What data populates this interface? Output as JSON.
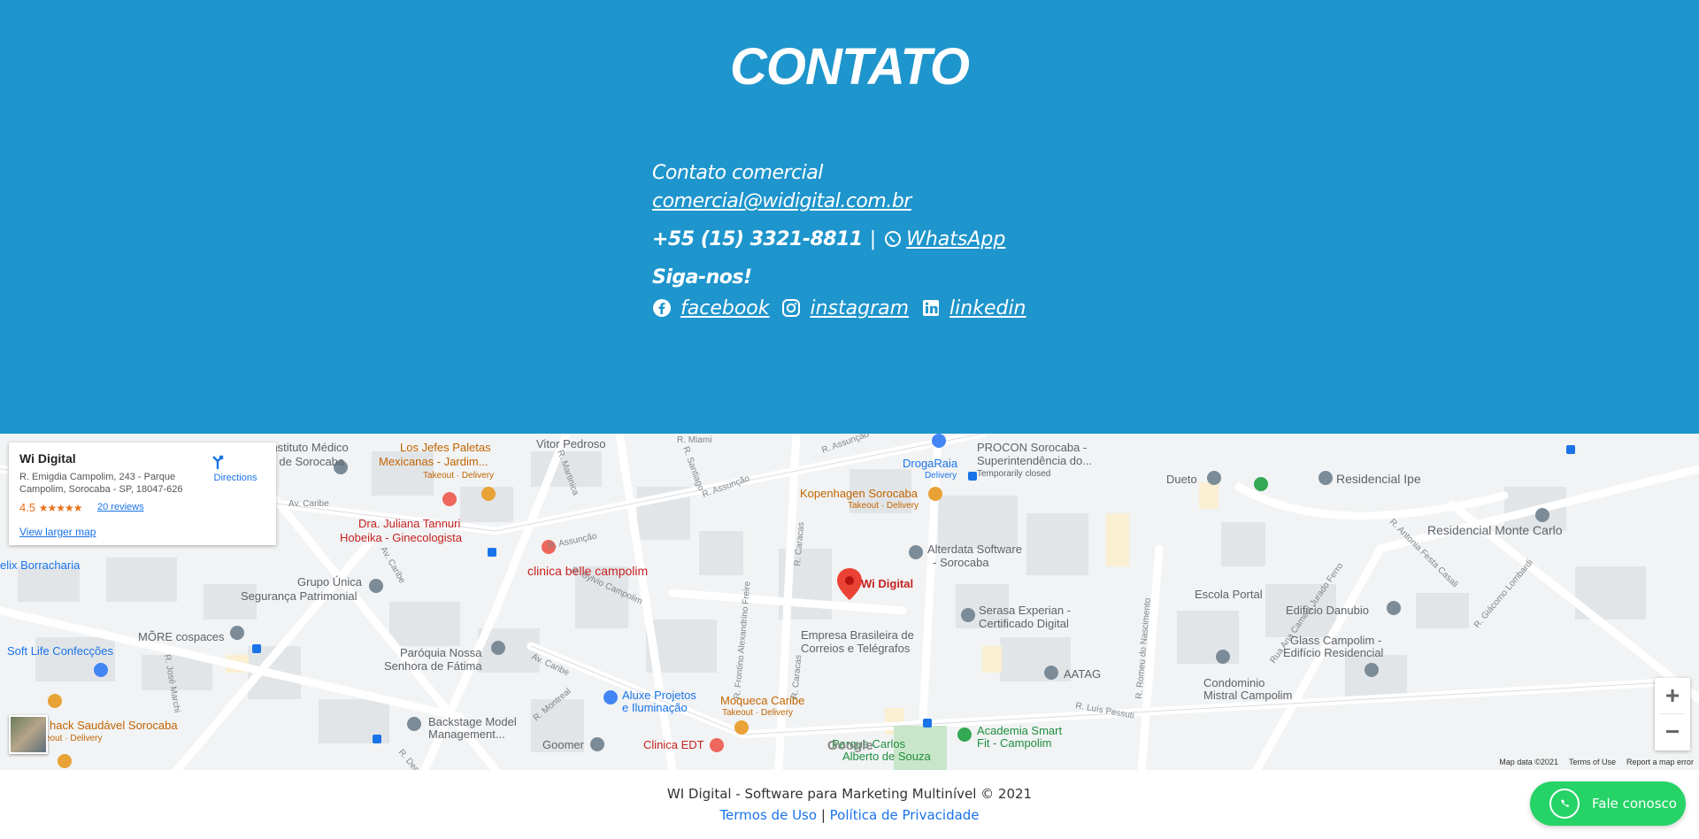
{
  "contact": {
    "title": "CONTATO",
    "commercial_label": "Contato comercial",
    "email": "comercial@widigital.com.br",
    "phone": "+55 (15) 3321-8811",
    "separator": "|",
    "whatsapp_label": " WhatsApp",
    "follow_label": "Siga-nos!",
    "social": {
      "facebook": "facebook",
      "instagram": "instagram",
      "linkedin": "linkedin"
    }
  },
  "map_card": {
    "name": "Wi Digital",
    "address": "R. Emigdia Campolim, 243 - Parque Campolim, Sorocaba - SP, 18047-626",
    "rating": "4.5",
    "stars": "★★★★★",
    "reviews": "20 reviews",
    "larger_map": "View larger map",
    "directions": "Directions"
  },
  "map_labels": {
    "pin_label": "Wi Digital",
    "places": [
      "IML - Instituto Médico Legal de Sorocaba",
      "Los Jefes Paletas Mexicanas - Jardim...",
      "Takeout · Delivery",
      "Vitor Pedroso",
      "DrogaRaia",
      "Delivery",
      "PROCON Sorocaba - Superintendência do...",
      "Temporarily closed",
      "Dueto",
      "Residencial Ipe",
      "Dra. Juliana Tannuri Hobeika - Ginecologista",
      "Kopenhagen Sorocaba",
      "Takeout · Delivery",
      "Residencial Monte Carlo",
      "Alterdata Software - Sorocaba",
      "elix Borracharia",
      "clinica belle campolim",
      "Grupo Única Segurança Patrimonial",
      "Escola Portal",
      "Edificio Danubio",
      "Serasa Experian - Certificado Digital",
      "MÕRE cospaces",
      "Empresa Brasileira de Correios e Telégrafos",
      "Glass Campolim - Edificio Residencial",
      "Soft Life Confecções",
      "Paróquia Nossa Senhora de Fátima",
      "AATAG",
      "Condominio Mistral Campolim",
      "Aluxe Projetos e Iluminação",
      "Moqueca Caribe",
      "Takeout · Delivery",
      "hack Saudável Sorocaba",
      "keout · Delivery",
      "Backstage Model Management...",
      "Academia Smart Fit - Campolim",
      "Goomer",
      "Clinica EDT",
      "Parque Carlos Alberto de Souza"
    ],
    "streets": [
      "Av. Caribe",
      "R. Assunção",
      "R. Martinica",
      "R. Santiago",
      "R. Miami",
      "R. Sylvio Campolim",
      "R. Caracas",
      "R. Frontino Alexandrino Freire",
      "R. José Marchi",
      "R. Montreal",
      "R. Luís Pessuti",
      "R. Romeu do Nascimento",
      "Rua Ana Camela Jurado Ferro",
      "R. Antonia Festa Casali",
      "R. Giácomo Lombardi",
      "R. Dep. Re"
    ]
  },
  "map_attrib": {
    "google": "Google",
    "data": "Map data ©2021",
    "terms": "Terms of Use",
    "report": "Report a map error"
  },
  "map_controls": {
    "zoom_in": "+",
    "zoom_out": "−"
  },
  "footer": {
    "copyright": "WI Digital - Software para Marketing Multinível © 2021",
    "terms": "Termos de Uso",
    "sep": "|",
    "privacy": "Política de Privacidade"
  },
  "whatsapp_button": {
    "label": "Fale conosco"
  },
  "colors": {
    "contact_bg": "#1e95cc",
    "whatsapp": "#25d366",
    "link": "#1a73e8",
    "map_bg": "#eef0f2"
  }
}
